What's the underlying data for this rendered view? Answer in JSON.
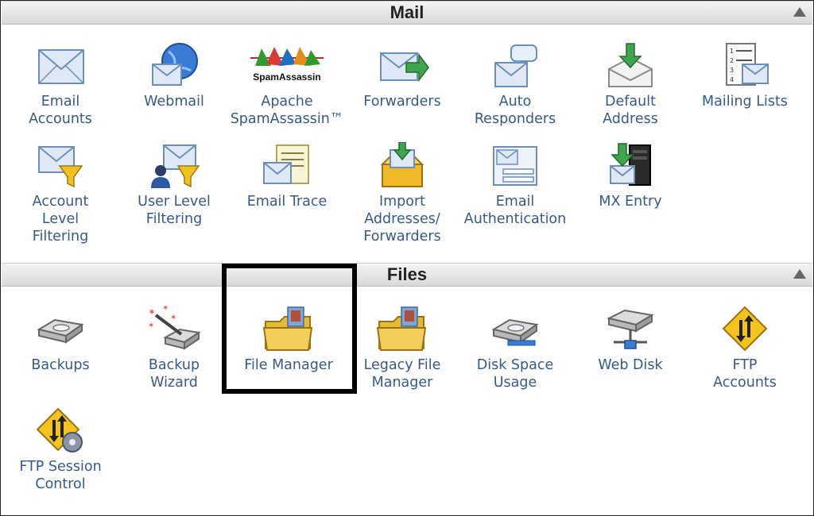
{
  "sections": {
    "mail": {
      "title": "Mail",
      "items": [
        {
          "label": "Email\nAccounts"
        },
        {
          "label": "Webmail"
        },
        {
          "label": "Apache\nSpamAssassin™",
          "logo_text": "SpamAssassin"
        },
        {
          "label": "Forwarders"
        },
        {
          "label": "Auto\nResponders"
        },
        {
          "label": "Default\nAddress"
        },
        {
          "label": "Mailing Lists"
        },
        {
          "label": "Account\nLevel\nFiltering"
        },
        {
          "label": "User Level\nFiltering"
        },
        {
          "label": "Email Trace"
        },
        {
          "label": "Import\nAddresses/\nForwarders"
        },
        {
          "label": "Email\nAuthentication"
        },
        {
          "label": "MX Entry"
        }
      ]
    },
    "files": {
      "title": "Files",
      "items": [
        {
          "label": "Backups"
        },
        {
          "label": "Backup\nWizard"
        },
        {
          "label": "File Manager"
        },
        {
          "label": "Legacy File\nManager"
        },
        {
          "label": "Disk Space\nUsage"
        },
        {
          "label": "Web Disk"
        },
        {
          "label": "FTP\nAccounts"
        },
        {
          "label": "FTP Session\nControl"
        }
      ]
    }
  },
  "colors": {
    "label": "#355a8a",
    "highlight": "#000000"
  }
}
